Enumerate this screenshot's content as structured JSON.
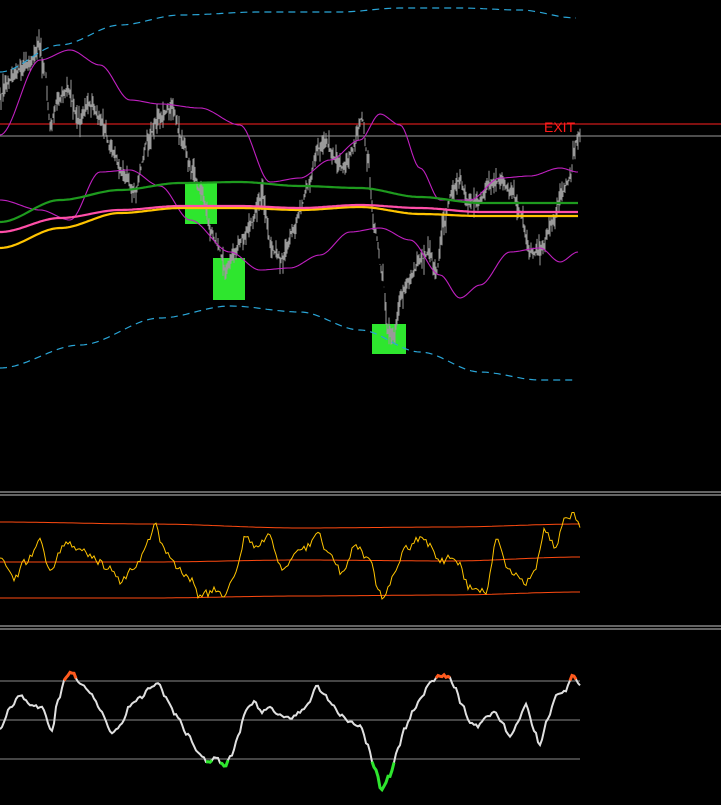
{
  "chart_data": [
    {
      "type": "line",
      "title": "",
      "annotations": [
        {
          "text": "EXIT",
          "color": "#ff1a1a"
        }
      ],
      "entry_zones": [
        "green",
        "green",
        "green"
      ],
      "colors": {
        "background": "#000000",
        "price": "#9a9a9a",
        "outer_band": "#2aa6d8",
        "inner_band": "#c020c0",
        "ma_green": "#1e9a1e",
        "ma_pink": "#ff4fa8",
        "ma_yellow": "#ffc400",
        "exit_line": "#ff2020",
        "entry_box": "#2ee62e"
      },
      "grid": false
    },
    {
      "type": "line",
      "title": "",
      "colors": {
        "signal": "#ffc400",
        "bands": "#ff4a10"
      },
      "grid": false
    },
    {
      "type": "line",
      "title": "",
      "colors": {
        "oscillator": "#e0e0e0",
        "overbought": "#ff5a1e",
        "oversold": "#2ee62e",
        "levels": "#8a8a8a"
      },
      "grid": false
    }
  ]
}
